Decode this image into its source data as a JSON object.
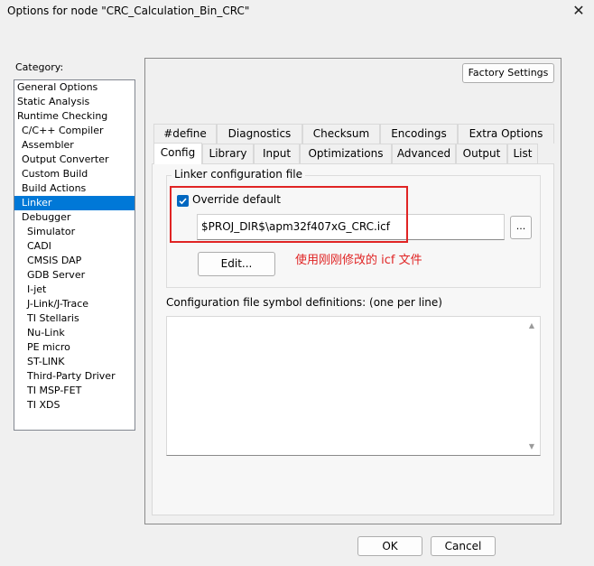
{
  "window": {
    "title": "Options for node \"CRC_Calculation_Bin_CRC\"",
    "close_glyph": "✕"
  },
  "category": {
    "label": "Category:",
    "items": [
      {
        "label": "General Options",
        "level": 0
      },
      {
        "label": "Static Analysis",
        "level": 0
      },
      {
        "label": "Runtime Checking",
        "level": 0
      },
      {
        "label": "C/C++ Compiler",
        "level": 1
      },
      {
        "label": "Assembler",
        "level": 1
      },
      {
        "label": "Output Converter",
        "level": 1
      },
      {
        "label": "Custom Build",
        "level": 1
      },
      {
        "label": "Build Actions",
        "level": 1
      },
      {
        "label": "Linker",
        "level": 1,
        "selected": true
      },
      {
        "label": "Debugger",
        "level": 1
      },
      {
        "label": "Simulator",
        "level": 2
      },
      {
        "label": "CADI",
        "level": 2
      },
      {
        "label": "CMSIS DAP",
        "level": 2
      },
      {
        "label": "GDB Server",
        "level": 2
      },
      {
        "label": "I-jet",
        "level": 2
      },
      {
        "label": "J-Link/J-Trace",
        "level": 2
      },
      {
        "label": "TI Stellaris",
        "level": 2
      },
      {
        "label": "Nu-Link",
        "level": 2
      },
      {
        "label": "PE micro",
        "level": 2
      },
      {
        "label": "ST-LINK",
        "level": 2
      },
      {
        "label": "Third-Party Driver",
        "level": 2
      },
      {
        "label": "TI MSP-FET",
        "level": 2
      },
      {
        "label": "TI XDS",
        "level": 2
      }
    ]
  },
  "factory_settings_label": "Factory Settings",
  "tabs_row1": [
    "#define",
    "Diagnostics",
    "Checksum",
    "Encodings",
    "Extra Options"
  ],
  "tabs_row2": [
    "Config",
    "Library",
    "Input",
    "Optimizations",
    "Advanced",
    "Output",
    "List"
  ],
  "active_tab": "Config",
  "linker_config": {
    "group_label": "Linker configuration file",
    "override_label": "Override default",
    "override_checked": true,
    "file_path": "$PROJ_DIR$\\apm32f407xG_CRC.icf",
    "browse_label": "...",
    "edit_label": "Edit...",
    "annotation": "使用刚刚修改的 icf 文件"
  },
  "symbol_defs": {
    "label": "Configuration file symbol definitions: (one per line)",
    "value": ""
  },
  "buttons": {
    "ok": "OK",
    "cancel": "Cancel"
  },
  "colors": {
    "selection": "#0078d7",
    "annotation": "#e02424",
    "checkbox": "#0067c0"
  }
}
